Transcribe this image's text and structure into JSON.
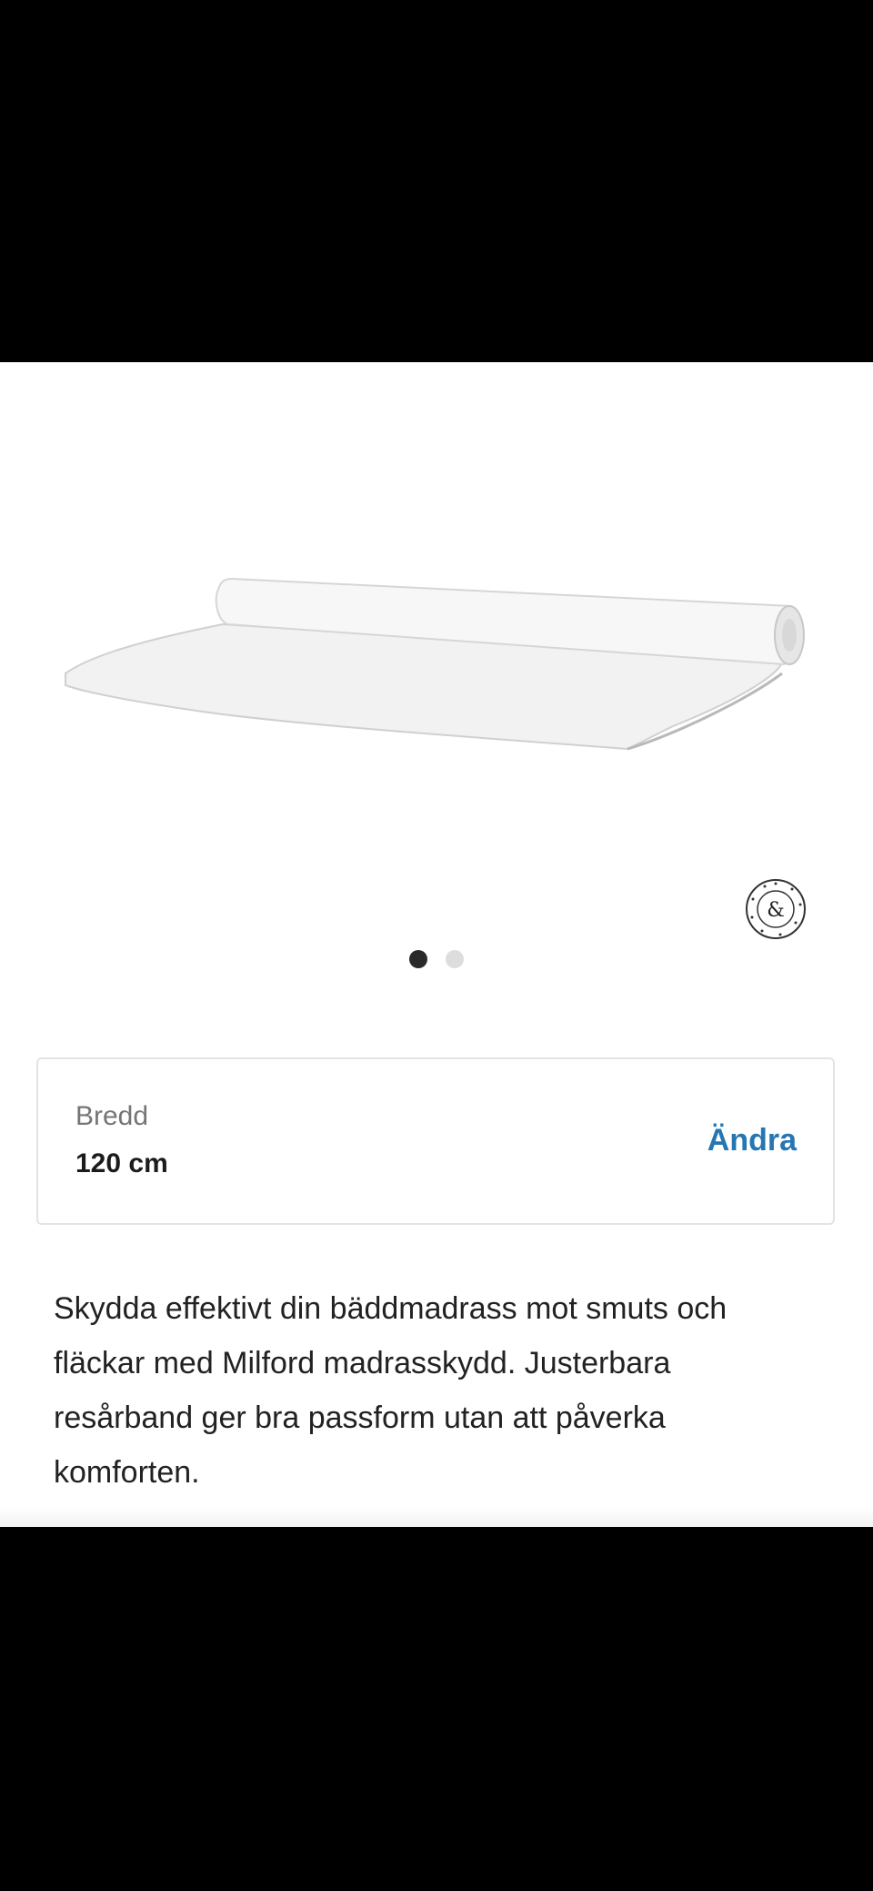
{
  "product": {
    "image_alt": "Milford madrasskydd",
    "brand_seal_icon": "brand-seal-icon"
  },
  "carousel": {
    "dots": 2,
    "active_index": 0
  },
  "size_selector": {
    "label": "Bredd",
    "value": "120 cm",
    "change_label": "Ändra"
  },
  "description": "Skydda effektivt din bäddmadrass mot smuts och fläckar med Milford madrasskydd. Justerbara resårband ger bra passform utan att påverka komforten.",
  "colors": {
    "accent": "#2676b3",
    "text": "#222222",
    "muted": "#757575"
  }
}
